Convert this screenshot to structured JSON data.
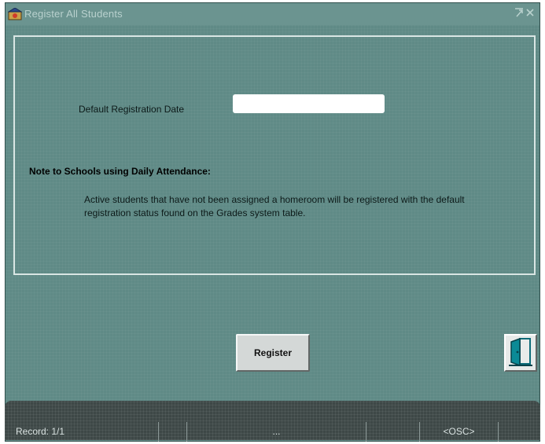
{
  "window": {
    "title": "Register All Students",
    "icon": "oracle-forms-app-icon",
    "controls": [
      "restore-icon",
      "close-icon"
    ]
  },
  "form": {
    "date_label": "Default Registration Date",
    "date_value": "",
    "note_heading": "Note to Schools using Daily Attendance:",
    "note_body": "Active students that have not been assigned a homeroom will be registered with the default registration status found on the Grades system table."
  },
  "buttons": {
    "register_label": "Register",
    "exit_icon": "exit-door-icon"
  },
  "status_bar": {
    "record": "Record: 1/1",
    "ellipsis": "...",
    "mode": "<OSC>"
  },
  "colors": {
    "window_bg": "#5f8a86",
    "panel_border": "#d9e6e4",
    "status_bg": "#3e4847"
  }
}
